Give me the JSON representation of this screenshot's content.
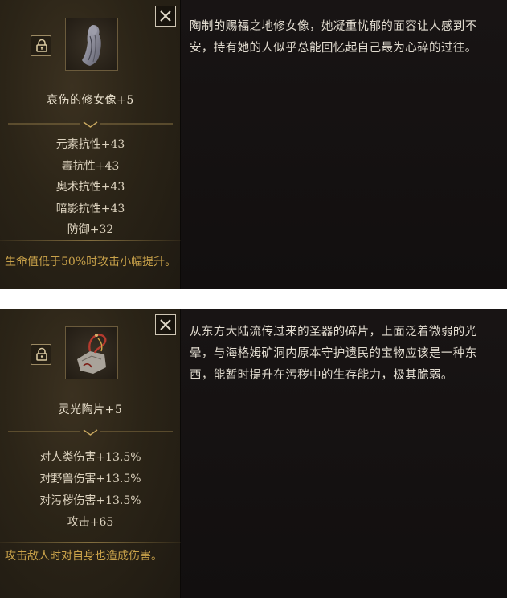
{
  "cards": [
    {
      "item_name": "哀伤的修女像+5",
      "stats": [
        "元素抗性+43",
        "毒抗性+43",
        "奥术抗性+43",
        "暗影抗性+43",
        "防御+32"
      ],
      "effect": "生命值低于50%时攻击小幅提升。",
      "description": "陶制的赐福之地修女像，她凝重忧郁的面容让人感到不安，持有她的人似乎总能回忆起自己最为心碎的过往。",
      "icon": "nun-statue-icon"
    },
    {
      "item_name": "灵光陶片+5",
      "stats": [
        "对人类伤害+13.5%",
        "对野兽伤害+13.5%",
        "对污秽伤害+13.5%",
        "攻击+65"
      ],
      "effect": "攻击敌人时对自身也造成伤害。",
      "description": "从东方大陆流传过来的圣器的碎片，上面泛着微弱的光晕，与海格姆矿洞内原本守护遗民的宝物应该是一种东西，能暂时提升在污秽中的生存能力，极其脆弱。",
      "icon": "pottery-shard-icon"
    }
  ],
  "colors": {
    "panel_left": "#2b2417",
    "panel_right": "#141111",
    "item_name": "#e8dfcc",
    "stat_text": "#ddd3bf",
    "effect_text": "#c9a24a",
    "description_text": "#e2dcd0"
  }
}
